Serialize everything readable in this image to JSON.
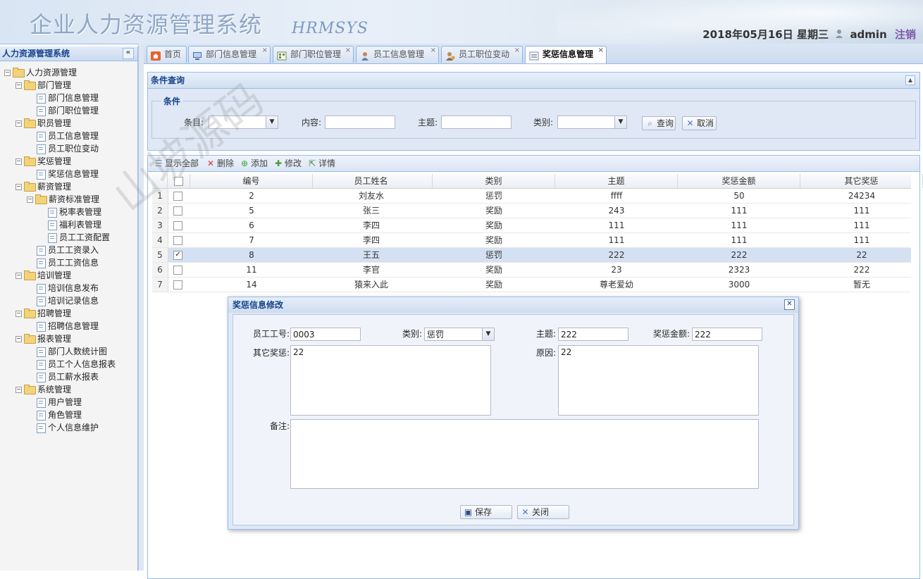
{
  "header": {
    "title": "企业人力资源管理系统",
    "subtitle": "HRMSYS",
    "date": "2018年05月16日 星期三",
    "user": "admin",
    "logout": "注销"
  },
  "sidebar": {
    "title": "人力资源管理系统",
    "collapse": "«",
    "tree": [
      {
        "label": "人力资源管理",
        "type": "folder",
        "level": 0
      },
      {
        "label": "部门管理",
        "type": "folder",
        "level": 1
      },
      {
        "label": "部门信息管理",
        "type": "leaf",
        "level": 2
      },
      {
        "label": "部门职位管理",
        "type": "leaf",
        "level": 2
      },
      {
        "label": "职员管理",
        "type": "folder",
        "level": 1
      },
      {
        "label": "员工信息管理",
        "type": "leaf",
        "level": 2
      },
      {
        "label": "员工职位变动",
        "type": "leaf",
        "level": 2
      },
      {
        "label": "奖惩管理",
        "type": "folder",
        "level": 1
      },
      {
        "label": "奖惩信息管理",
        "type": "leaf",
        "level": 2
      },
      {
        "label": "薪资管理",
        "type": "folder",
        "level": 1
      },
      {
        "label": "薪资标准管理",
        "type": "folder",
        "level": 2
      },
      {
        "label": "税率表管理",
        "type": "leaf",
        "level": 3
      },
      {
        "label": "福利表管理",
        "type": "leaf",
        "level": 3
      },
      {
        "label": "员工工资配置",
        "type": "leaf",
        "level": 3
      },
      {
        "label": "员工工资录入",
        "type": "leaf",
        "level": 2
      },
      {
        "label": "员工工资信息",
        "type": "leaf",
        "level": 2
      },
      {
        "label": "培训管理",
        "type": "folder",
        "level": 1
      },
      {
        "label": "培训信息发布",
        "type": "leaf",
        "level": 2
      },
      {
        "label": "培训记录信息",
        "type": "leaf",
        "level": 2
      },
      {
        "label": "招聘管理",
        "type": "folder",
        "level": 1
      },
      {
        "label": "招聘信息管理",
        "type": "leaf",
        "level": 2
      },
      {
        "label": "报表管理",
        "type": "folder",
        "level": 1
      },
      {
        "label": "部门人数统计图",
        "type": "leaf",
        "level": 2
      },
      {
        "label": "员工个人信息报表",
        "type": "leaf",
        "level": 2
      },
      {
        "label": "员工薪水报表",
        "type": "leaf",
        "level": 2
      },
      {
        "label": "系统管理",
        "type": "folder",
        "level": 1
      },
      {
        "label": "用户管理",
        "type": "leaf",
        "level": 2
      },
      {
        "label": "角色管理",
        "type": "leaf",
        "level": 2
      },
      {
        "label": "个人信息维护",
        "type": "leaf",
        "level": 2
      }
    ]
  },
  "tabs": [
    {
      "label": "首页",
      "icon": "home-icon",
      "closable": false,
      "active": false
    },
    {
      "label": "部门信息管理",
      "icon": "monitor-icon",
      "closable": true,
      "active": false
    },
    {
      "label": "部门职位管理",
      "icon": "grid-icon",
      "closable": true,
      "active": false
    },
    {
      "label": "员工信息管理",
      "icon": "user-icon",
      "closable": true,
      "active": false
    },
    {
      "label": "员工职位变动",
      "icon": "user-switch-icon",
      "closable": true,
      "active": false
    },
    {
      "label": "奖惩信息管理",
      "icon": "list-icon",
      "closable": true,
      "active": true
    }
  ],
  "query": {
    "panel_title": "条件查询",
    "legend": "条件",
    "item_label": "条目:",
    "content_label": "内容:",
    "subject_label": "主题:",
    "category_label": "类别:",
    "search_btn": "查询",
    "cancel_btn": "取消"
  },
  "toolbar": {
    "show_all": "显示全部",
    "delete": "删除",
    "add": "添加",
    "edit": "修改",
    "detail": "详情"
  },
  "grid": {
    "columns": [
      "编号",
      "员工姓名",
      "类别",
      "主题",
      "奖惩金额",
      "其它奖惩"
    ],
    "rows": [
      {
        "n": "1",
        "checked": false,
        "id": "2",
        "name": "刘友水",
        "cat": "惩罚",
        "subject": "ffff",
        "amount": "50",
        "other": "24234"
      },
      {
        "n": "2",
        "checked": false,
        "id": "5",
        "name": "张三",
        "cat": "奖励",
        "subject": "243",
        "amount": "111",
        "other": "111"
      },
      {
        "n": "3",
        "checked": false,
        "id": "6",
        "name": "李四",
        "cat": "奖励",
        "subject": "111",
        "amount": "111",
        "other": "111"
      },
      {
        "n": "4",
        "checked": false,
        "id": "7",
        "name": "李四",
        "cat": "奖励",
        "subject": "111",
        "amount": "111",
        "other": "111"
      },
      {
        "n": "5",
        "checked": true,
        "id": "8",
        "name": "王五",
        "cat": "惩罚",
        "subject": "222",
        "amount": "222",
        "other": "22"
      },
      {
        "n": "6",
        "checked": false,
        "id": "11",
        "name": "李官",
        "cat": "奖励",
        "subject": "23",
        "amount": "2323",
        "other": "222"
      },
      {
        "n": "7",
        "checked": false,
        "id": "14",
        "name": "猿来入此",
        "cat": "奖励",
        "subject": "尊老爱幼",
        "amount": "3000",
        "other": "暂无"
      }
    ]
  },
  "dialog": {
    "title": "奖惩信息修改",
    "emp_no_label": "员工工号:",
    "emp_no": "0003",
    "category_label": "类别:",
    "category": "惩罚",
    "subject_label": "主题:",
    "subject": "222",
    "amount_label": "奖惩金额:",
    "amount": "222",
    "other_label": "其它奖惩:",
    "other": "22",
    "reason_label": "原因:",
    "reason": "22",
    "remark_label": "备注:",
    "remark": "",
    "save_btn": "保存",
    "close_btn": "关闭"
  },
  "watermark": "山坡源码"
}
